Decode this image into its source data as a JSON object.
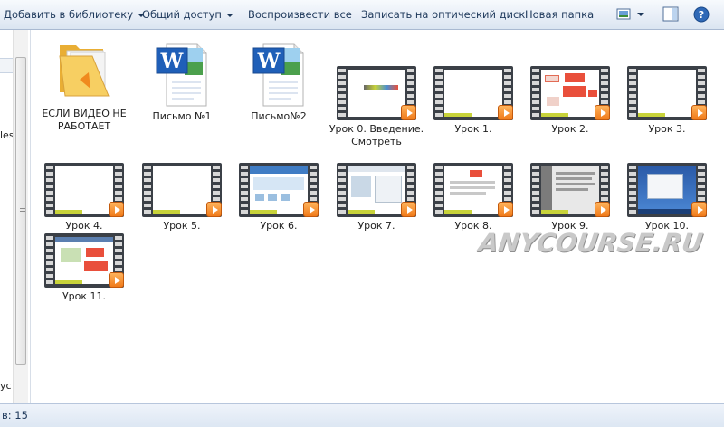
{
  "toolbar": {
    "library": "Добавить в библиотеку",
    "share": "Общий доступ",
    "play_all": "Воспроизвести все",
    "burn": "Записать на оптический диск",
    "new_folder": "Новая папка"
  },
  "left_pane": {
    "text_1": "les",
    "text_2": "ус"
  },
  "items": [
    {
      "label": "ЕСЛИ ВИДЕО НЕ РАБОТАЕТ",
      "type": "folder"
    },
    {
      "label": "Письмо №1",
      "type": "word"
    },
    {
      "label": "Письмо№2",
      "type": "word"
    },
    {
      "label": "Урок 0. Введение. Смотреть",
      "type": "video"
    },
    {
      "label": "Урок 1.",
      "type": "video"
    },
    {
      "label": "Урок 2.",
      "type": "video"
    },
    {
      "label": "Урок 3.",
      "type": "video"
    },
    {
      "label": "Урок 4.",
      "type": "video"
    },
    {
      "label": "Урок 5.",
      "type": "video"
    },
    {
      "label": "Урок 6.",
      "type": "video"
    },
    {
      "label": "Урок 7.",
      "type": "video"
    },
    {
      "label": "Урок 8.",
      "type": "video"
    },
    {
      "label": "Урок 9.",
      "type": "video"
    },
    {
      "label": "Урок 10.",
      "type": "video"
    },
    {
      "label": "Урок 11.",
      "type": "video"
    }
  ],
  "watermark": "ANYCOURSE.RU",
  "status": {
    "text": "в: 15"
  },
  "colors": {
    "toolbar_text": "#1e395b",
    "play_badge": "#f07a1a",
    "folder": "#f2c14e"
  }
}
